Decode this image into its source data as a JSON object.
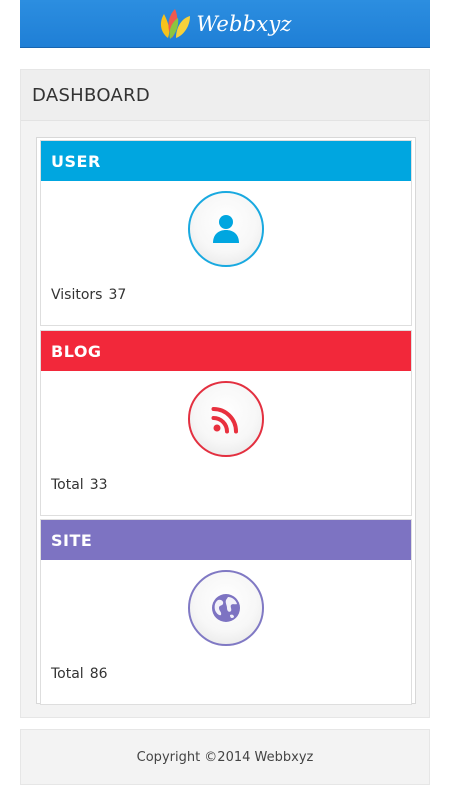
{
  "header": {
    "logo_text": "Webbxyz",
    "logo_icon": "leaf-logo-icon",
    "background": "#2588dc"
  },
  "panel": {
    "title": "DASHBOARD"
  },
  "cards": [
    {
      "title": "USER",
      "color": "#00a6e0",
      "icon": "user-icon",
      "footer_label": "Visitors",
      "footer_value": "37"
    },
    {
      "title": "BLOG",
      "color": "#f2283a",
      "icon": "rss-icon",
      "footer_label": "Total",
      "footer_value": "33"
    },
    {
      "title": "SITE",
      "color": "#7d73c2",
      "icon": "globe-icon",
      "footer_label": "Total",
      "footer_value": "86"
    }
  ],
  "footer": {
    "copyright": "Copyright ©2014 Webbxyz"
  }
}
